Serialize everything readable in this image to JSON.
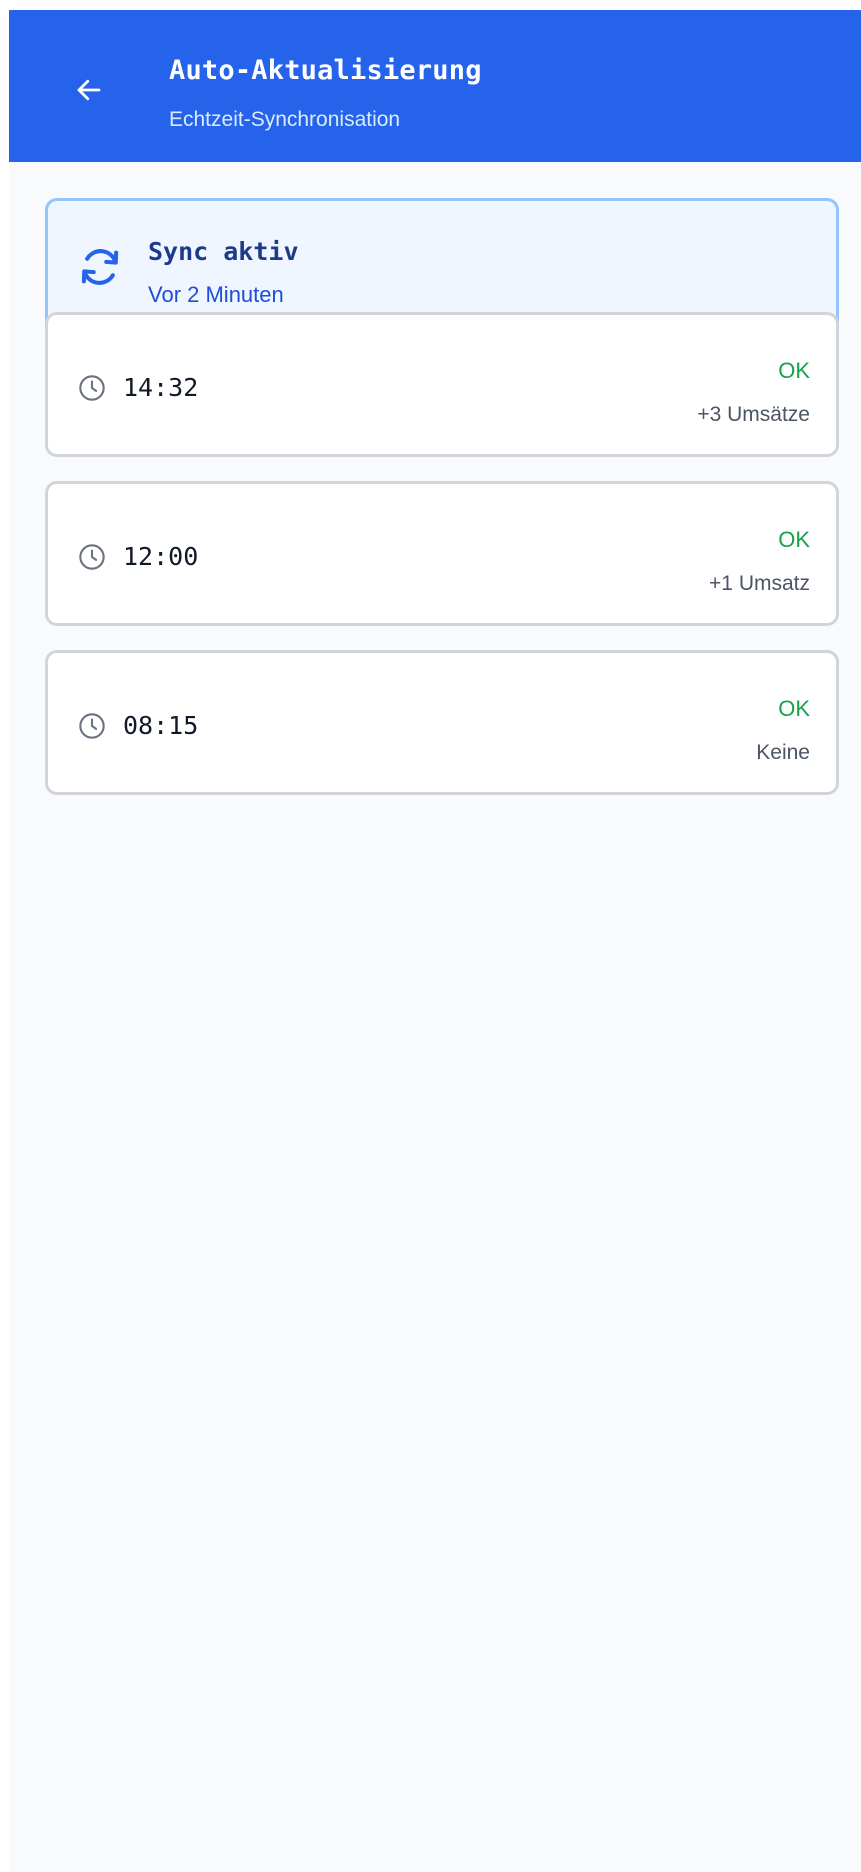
{
  "header": {
    "title": "Auto-Aktualisierung",
    "subtitle": "Echtzeit-Synchronisation",
    "back_icon": "arrow-left-icon",
    "background_color": "#2563eb"
  },
  "status": {
    "icon": "sync-icon",
    "title": "Sync aktiv",
    "last_sync": "Vor 2 Minuten"
  },
  "history": [
    {
      "icon": "clock-icon",
      "time": "14:32",
      "status": "OK",
      "detail": "+3 Umsätze"
    },
    {
      "icon": "clock-icon",
      "time": "12:00",
      "status": "OK",
      "detail": "+1 Umsatz"
    },
    {
      "icon": "clock-icon",
      "time": "08:15",
      "status": "OK",
      "detail": "Keine"
    }
  ],
  "colors": {
    "accent": "#2563eb",
    "success": "#16a34a"
  }
}
